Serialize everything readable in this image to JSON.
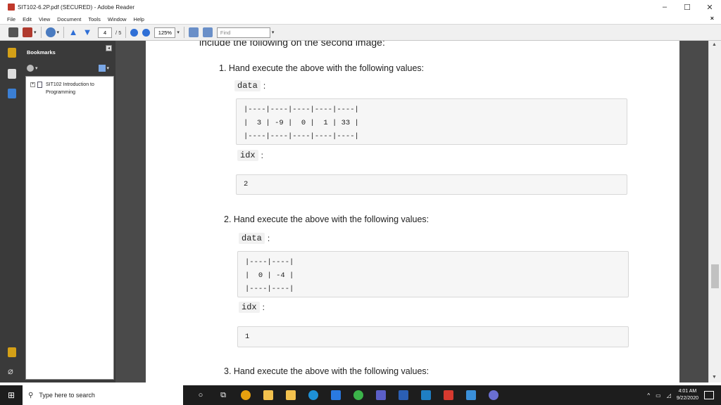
{
  "window": {
    "title": "SIT102-6.2P.pdf (SECURED) - Adobe Reader",
    "controls": {
      "minimize": "–",
      "maximize": "☐",
      "close": "✕"
    }
  },
  "menu": {
    "items": [
      "File",
      "Edit",
      "View",
      "Document",
      "Tools",
      "Window",
      "Help"
    ],
    "close_doc": "×"
  },
  "toolbar": {
    "page_current": "4",
    "page_total": "/ 5",
    "zoom": "125%",
    "find_placeholder": "Find"
  },
  "bookmarks": {
    "header": "Bookmarks",
    "collapse": "◂",
    "items": [
      {
        "label": "SIT102 Introduction to Programming",
        "expand": "+"
      }
    ]
  },
  "document": {
    "cut_line": "include the following on the second image:",
    "questions": [
      {
        "text": "1. Hand execute the above with the following values:",
        "data_label": "data",
        "data_table": "|----|----|----|----|----|\n|  3 | -9 |  0 |  1 | 33 |\n|----|----|----|----|----|",
        "idx_label": "idx",
        "idx_value": "2"
      },
      {
        "text": "2. Hand execute the above with the following values:",
        "data_label": "data",
        "data_table": "|----|----|\n|  0 | -4 |\n|----|----|",
        "idx_label": "idx",
        "idx_value": "1"
      },
      {
        "text": "3. Hand execute the above with the following values:"
      }
    ],
    "colon": ":"
  },
  "taskbar": {
    "search_placeholder": "Type here to search",
    "time": "4:01 AM",
    "date": "9/22/2020"
  },
  "colors": {
    "panel_dark": "#3a3a3a",
    "taskbar": "#1d1d1d",
    "pdf_red": "#c0392b"
  }
}
